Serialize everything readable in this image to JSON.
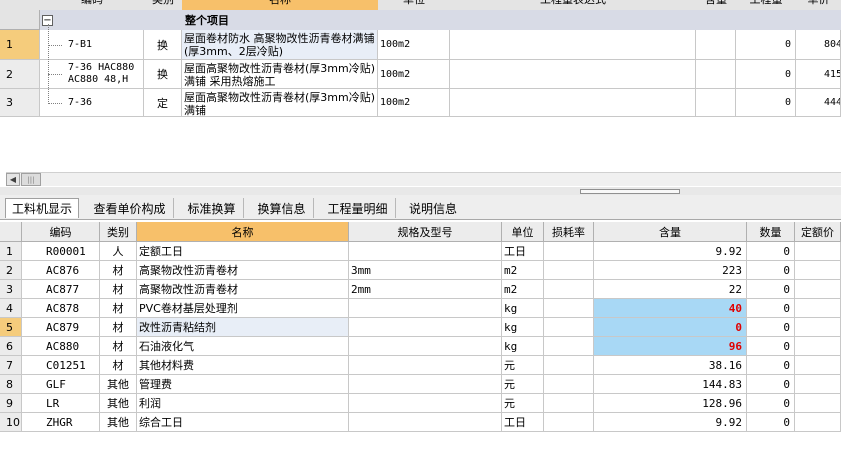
{
  "top_grid": {
    "headers": [
      "编码",
      "类别",
      "名称",
      "单位",
      "工程量表达式",
      "含量",
      "工程量",
      "单价"
    ],
    "group_row": {
      "toggle": "−",
      "label": "整个项目"
    },
    "rows": [
      {
        "num": "1",
        "code": "7-B1",
        "type": "换",
        "name": "屋面卷材防水 高聚物改性沥青卷材满铺(厚3mm、2层冷贴)",
        "unit": "100m2",
        "expr": "",
        "content": "",
        "qty": "0",
        "price": "804"
      },
      {
        "num": "2",
        "code": "7-36 HAC880\nAC880 48,H",
        "type": "换",
        "name": "屋面高聚物改性沥青卷材(厚3mm冷贴)满铺 采用热熔施工",
        "unit": "100m2",
        "expr": "",
        "content": "",
        "qty": "0",
        "price": "415"
      },
      {
        "num": "3",
        "code": "7-36",
        "type": "定",
        "name": "屋面高聚物改性沥青卷材(厚3mm冷贴)满铺",
        "unit": "100m2",
        "expr": "",
        "content": "",
        "qty": "0",
        "price": "444"
      }
    ]
  },
  "scroll": {
    "left_arrow": "◀",
    "thumb_grip": "|||"
  },
  "tabs": [
    "工料机显示",
    "查看单价构成",
    "标准换算",
    "换算信息",
    "工程量明细",
    "说明信息"
  ],
  "bottom_grid": {
    "headers": [
      "编码",
      "类别",
      "名称",
      "规格及型号",
      "单位",
      "损耗率",
      "含量",
      "数量",
      "定额价"
    ],
    "rows": [
      {
        "num": "1",
        "code": "R00001",
        "type": "人",
        "name": "定额工日",
        "spec": "",
        "unit": "工日",
        "loss": "",
        "content": "9.92",
        "qty": "0",
        "highlight": false
      },
      {
        "num": "2",
        "code": "AC876",
        "type": "材",
        "name": "高聚物改性沥青卷材",
        "spec": "3mm",
        "unit": "m2",
        "loss": "",
        "content": "223",
        "qty": "0",
        "highlight": false
      },
      {
        "num": "3",
        "code": "AC877",
        "type": "材",
        "name": "高聚物改性沥青卷材",
        "spec": "2mm",
        "unit": "m2",
        "loss": "",
        "content": "22",
        "qty": "0",
        "highlight": false
      },
      {
        "num": "4",
        "code": "AC878",
        "type": "材",
        "name": "PVC卷材基层处理剂",
        "spec": "",
        "unit": "kg",
        "loss": "",
        "content": "40",
        "qty": "0",
        "highlight": true
      },
      {
        "num": "5",
        "code": "AC879",
        "type": "材",
        "name": "改性沥青粘结剂",
        "spec": "",
        "unit": "kg",
        "loss": "",
        "content": "0",
        "qty": "0",
        "highlight": true
      },
      {
        "num": "6",
        "code": "AC880",
        "type": "材",
        "name": "石油液化气",
        "spec": "",
        "unit": "kg",
        "loss": "",
        "content": "96",
        "qty": "0",
        "highlight": true
      },
      {
        "num": "7",
        "code": "C01251",
        "type": "材",
        "name": "其他材料费",
        "spec": "",
        "unit": "元",
        "loss": "",
        "content": "38.16",
        "qty": "0",
        "highlight": false
      },
      {
        "num": "8",
        "code": "GLF",
        "type": "其他",
        "name": "管理费",
        "spec": "",
        "unit": "元",
        "loss": "",
        "content": "144.83",
        "qty": "0",
        "highlight": false
      },
      {
        "num": "9",
        "code": "LR",
        "type": "其他",
        "name": "利润",
        "spec": "",
        "unit": "元",
        "loss": "",
        "content": "128.96",
        "qty": "0",
        "highlight": false
      },
      {
        "num": "10",
        "code": "ZHGR",
        "type": "其他",
        "name": "综合工日",
        "spec": "",
        "unit": "工日",
        "loss": "",
        "content": "9.92",
        "qty": "0",
        "highlight": false
      }
    ]
  },
  "colors": {
    "selected_header": "#f7c06a",
    "highlight_cell": "#a8d8f5",
    "value_red": "#e00000",
    "group_row": "#d8dbe6"
  }
}
